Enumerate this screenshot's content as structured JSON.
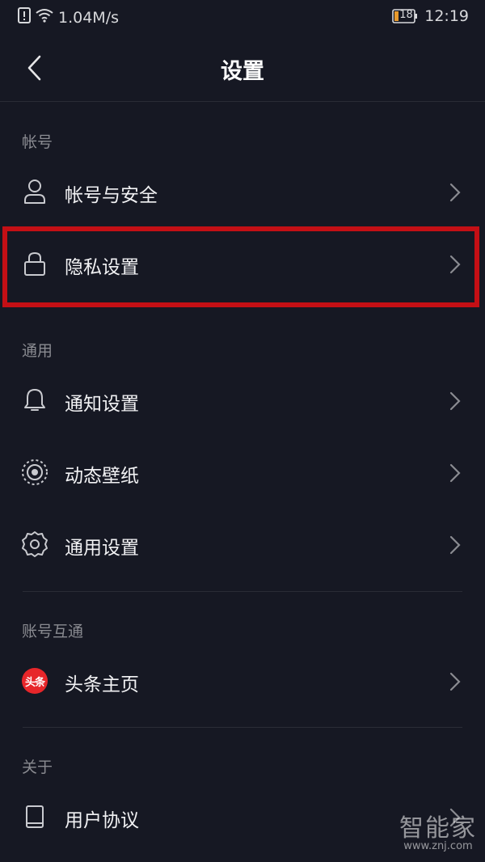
{
  "status_bar": {
    "speed": "1.04M/s",
    "battery": "18",
    "time": "12:19"
  },
  "nav": {
    "title": "设置"
  },
  "sections": {
    "account": {
      "header": "帐号"
    },
    "general": {
      "header": "通用"
    },
    "linked": {
      "header": "账号互通"
    },
    "about": {
      "header": "关于"
    }
  },
  "rows": {
    "account_security": {
      "label": "帐号与安全",
      "icon": "user-icon"
    },
    "privacy": {
      "label": "隐私设置",
      "icon": "lock-icon"
    },
    "notifications": {
      "label": "通知设置",
      "icon": "bell-icon"
    },
    "wallpaper": {
      "label": "动态壁纸",
      "icon": "live-wallpaper-icon"
    },
    "general_settings": {
      "label": "通用设置",
      "icon": "gear-icon"
    },
    "toutiao": {
      "label": "头条主页",
      "icon": "toutiao-logo",
      "logo_text": "头条"
    },
    "user_agreement": {
      "label": "用户协议",
      "icon": "book-icon"
    }
  },
  "highlight_color": "#c40f15",
  "watermark": {
    "title": "智能家",
    "url": "www.znj.com"
  }
}
